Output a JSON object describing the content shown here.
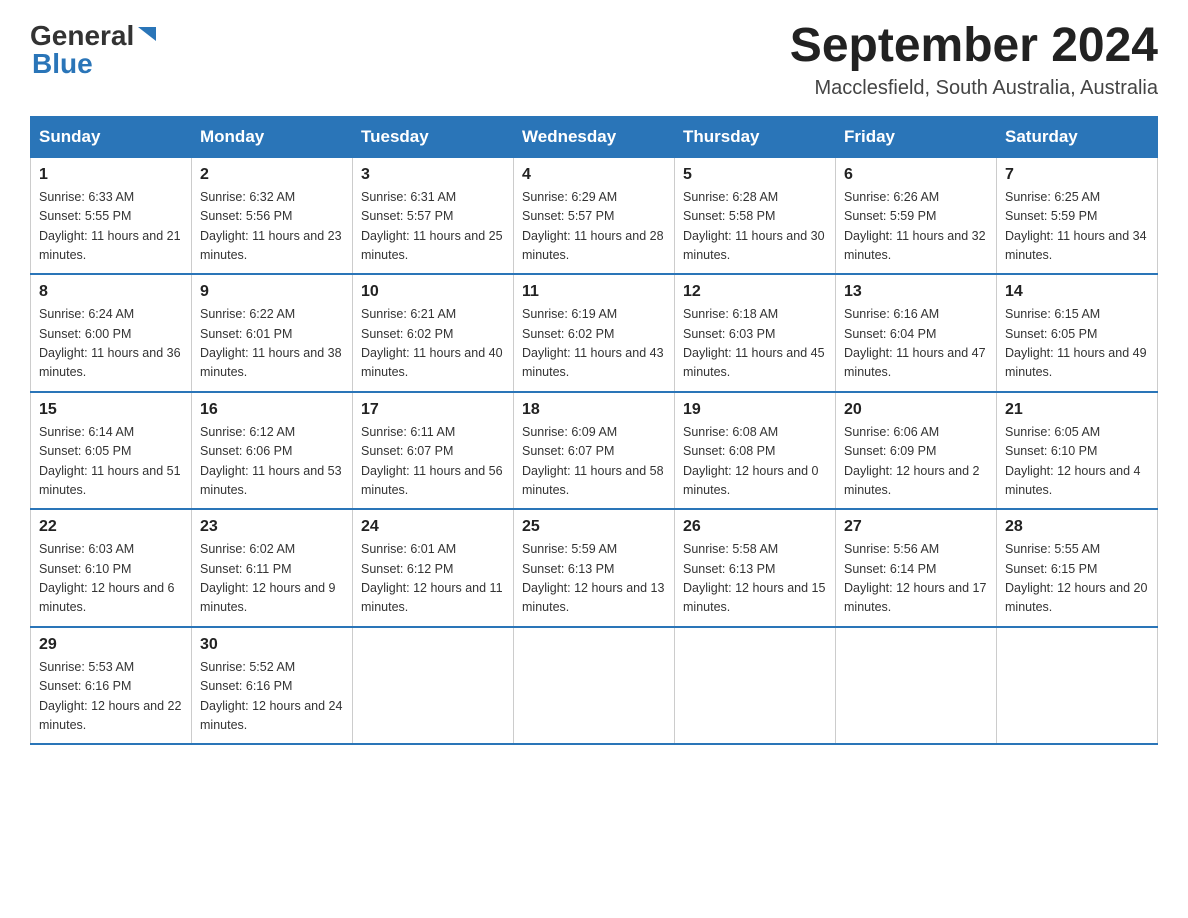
{
  "header": {
    "logo_general": "General",
    "logo_blue": "Blue",
    "month_year": "September 2024",
    "location": "Macclesfield, South Australia, Australia"
  },
  "weekdays": [
    "Sunday",
    "Monday",
    "Tuesday",
    "Wednesday",
    "Thursday",
    "Friday",
    "Saturday"
  ],
  "weeks": [
    [
      {
        "day": "1",
        "sunrise": "6:33 AM",
        "sunset": "5:55 PM",
        "daylight": "11 hours and 21 minutes."
      },
      {
        "day": "2",
        "sunrise": "6:32 AM",
        "sunset": "5:56 PM",
        "daylight": "11 hours and 23 minutes."
      },
      {
        "day": "3",
        "sunrise": "6:31 AM",
        "sunset": "5:57 PM",
        "daylight": "11 hours and 25 minutes."
      },
      {
        "day": "4",
        "sunrise": "6:29 AM",
        "sunset": "5:57 PM",
        "daylight": "11 hours and 28 minutes."
      },
      {
        "day": "5",
        "sunrise": "6:28 AM",
        "sunset": "5:58 PM",
        "daylight": "11 hours and 30 minutes."
      },
      {
        "day": "6",
        "sunrise": "6:26 AM",
        "sunset": "5:59 PM",
        "daylight": "11 hours and 32 minutes."
      },
      {
        "day": "7",
        "sunrise": "6:25 AM",
        "sunset": "5:59 PM",
        "daylight": "11 hours and 34 minutes."
      }
    ],
    [
      {
        "day": "8",
        "sunrise": "6:24 AM",
        "sunset": "6:00 PM",
        "daylight": "11 hours and 36 minutes."
      },
      {
        "day": "9",
        "sunrise": "6:22 AM",
        "sunset": "6:01 PM",
        "daylight": "11 hours and 38 minutes."
      },
      {
        "day": "10",
        "sunrise": "6:21 AM",
        "sunset": "6:02 PM",
        "daylight": "11 hours and 40 minutes."
      },
      {
        "day": "11",
        "sunrise": "6:19 AM",
        "sunset": "6:02 PM",
        "daylight": "11 hours and 43 minutes."
      },
      {
        "day": "12",
        "sunrise": "6:18 AM",
        "sunset": "6:03 PM",
        "daylight": "11 hours and 45 minutes."
      },
      {
        "day": "13",
        "sunrise": "6:16 AM",
        "sunset": "6:04 PM",
        "daylight": "11 hours and 47 minutes."
      },
      {
        "day": "14",
        "sunrise": "6:15 AM",
        "sunset": "6:05 PM",
        "daylight": "11 hours and 49 minutes."
      }
    ],
    [
      {
        "day": "15",
        "sunrise": "6:14 AM",
        "sunset": "6:05 PM",
        "daylight": "11 hours and 51 minutes."
      },
      {
        "day": "16",
        "sunrise": "6:12 AM",
        "sunset": "6:06 PM",
        "daylight": "11 hours and 53 minutes."
      },
      {
        "day": "17",
        "sunrise": "6:11 AM",
        "sunset": "6:07 PM",
        "daylight": "11 hours and 56 minutes."
      },
      {
        "day": "18",
        "sunrise": "6:09 AM",
        "sunset": "6:07 PM",
        "daylight": "11 hours and 58 minutes."
      },
      {
        "day": "19",
        "sunrise": "6:08 AM",
        "sunset": "6:08 PM",
        "daylight": "12 hours and 0 minutes."
      },
      {
        "day": "20",
        "sunrise": "6:06 AM",
        "sunset": "6:09 PM",
        "daylight": "12 hours and 2 minutes."
      },
      {
        "day": "21",
        "sunrise": "6:05 AM",
        "sunset": "6:10 PM",
        "daylight": "12 hours and 4 minutes."
      }
    ],
    [
      {
        "day": "22",
        "sunrise": "6:03 AM",
        "sunset": "6:10 PM",
        "daylight": "12 hours and 6 minutes."
      },
      {
        "day": "23",
        "sunrise": "6:02 AM",
        "sunset": "6:11 PM",
        "daylight": "12 hours and 9 minutes."
      },
      {
        "day": "24",
        "sunrise": "6:01 AM",
        "sunset": "6:12 PM",
        "daylight": "12 hours and 11 minutes."
      },
      {
        "day": "25",
        "sunrise": "5:59 AM",
        "sunset": "6:13 PM",
        "daylight": "12 hours and 13 minutes."
      },
      {
        "day": "26",
        "sunrise": "5:58 AM",
        "sunset": "6:13 PM",
        "daylight": "12 hours and 15 minutes."
      },
      {
        "day": "27",
        "sunrise": "5:56 AM",
        "sunset": "6:14 PM",
        "daylight": "12 hours and 17 minutes."
      },
      {
        "day": "28",
        "sunrise": "5:55 AM",
        "sunset": "6:15 PM",
        "daylight": "12 hours and 20 minutes."
      }
    ],
    [
      {
        "day": "29",
        "sunrise": "5:53 AM",
        "sunset": "6:16 PM",
        "daylight": "12 hours and 22 minutes."
      },
      {
        "day": "30",
        "sunrise": "5:52 AM",
        "sunset": "6:16 PM",
        "daylight": "12 hours and 24 minutes."
      },
      null,
      null,
      null,
      null,
      null
    ]
  ]
}
